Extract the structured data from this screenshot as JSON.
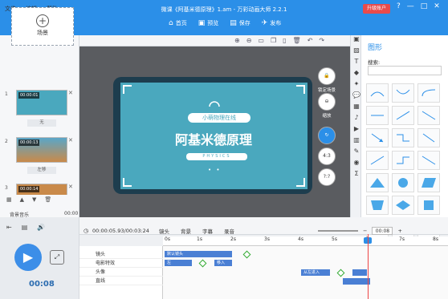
{
  "window": {
    "menu": [
      "文件",
      "编辑",
      "帮助"
    ],
    "title": "微课《阿基米德原理》1.am - 万彩动画大师 2.2.1",
    "upgrade_label": "升级账户"
  },
  "toolbar": {
    "home_label": "首页",
    "preview_label": "预览",
    "save_label": "保存",
    "publish_label": "发布"
  },
  "left_panel": {
    "add_scene_label": "场景",
    "scenes": [
      {
        "num": "1",
        "time": "00:00:01",
        "transition": "无"
      },
      {
        "num": "2",
        "time": "00:00:13",
        "transition": "左移"
      },
      {
        "num": "3",
        "time": "00:00:14",
        "transition": ""
      }
    ],
    "bg_music_label": "背景音乐",
    "bg_music_time": "00:00"
  },
  "stage": {
    "class_title": "小萌物理在线",
    "main_title": "阿基米德原理",
    "subtitle": "PHYSICS"
  },
  "float_tools": {
    "lock_label": "锁定场景",
    "zoom_label": "缩放",
    "ratio_label": "4:3",
    "help_label": "?:?"
  },
  "shape_panel": {
    "title": "图形",
    "search_label": "搜索:"
  },
  "timeline": {
    "timecode": "00:00:05.93/00:03:24",
    "tabs": [
      "镜头",
      "背景",
      "字幕",
      "录音"
    ],
    "zoom": "00:08",
    "ticks": [
      "0s",
      "1s",
      "2s",
      "3s",
      "4s",
      "5s",
      "6s",
      "7s",
      "8s"
    ],
    "tracks": [
      "镜头",
      "电影特效",
      "头像",
      "直线"
    ],
    "bars": {
      "camera": "默认镜头",
      "fx1": "左",
      "fx2": "移入",
      "head": "从左进入"
    }
  },
  "player": {
    "time": "00:08"
  },
  "colors": {
    "brand": "#2b8fe8",
    "stage_bg": "#4aa8be",
    "stage_frame": "#1d3d4e",
    "upgrade": "#e94b4b"
  }
}
